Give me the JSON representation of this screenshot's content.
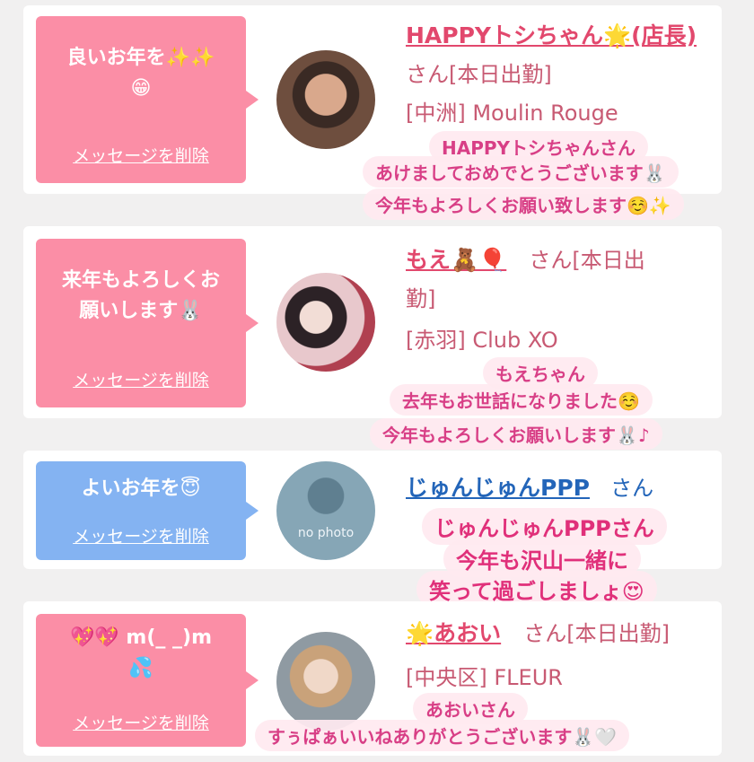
{
  "cards": [
    {
      "message": "良いお年を✨✨\n😁",
      "delete_label": "メッセージを削除",
      "name": "HAPPYトシちゃん🌟(店長)",
      "suffix": "さん[本日出勤]",
      "shop": "[中洲] Moulin Rouge",
      "overlay": [
        "HAPPYトシちゃんさん",
        "あけましておめでとうございます🐰",
        "今年もよろしくお願い致します☺️✨"
      ]
    },
    {
      "message": "来年もよろしくお\n願いします🐰",
      "delete_label": "メッセージを削除",
      "name": "もえ🧸🎈",
      "suffix": "さん[本日出",
      "suffix2": "勤]",
      "shop": "[赤羽] Club XO",
      "overlay": [
        "もえちゃん",
        "去年もお世話になりました☺️",
        "今年もよろしくお願いします🐰♪"
      ]
    },
    {
      "message": "よいお年を😇",
      "delete_label": "メッセージを削除",
      "name": "じゅんじゅんPPP",
      "suffix": "さん",
      "avatar_text": "no photo",
      "overlay": [
        "じゅんじゅんPPPさん",
        "今年も沢山一緒に",
        "笑って過ごしましょ😍"
      ]
    },
    {
      "message": "💖💖    m(_ _)m\n💦",
      "delete_label": "メッセージを削除",
      "name": "🌟あおい",
      "suffix": "さん[本日出勤]",
      "shop": "[中央区] FLEUR",
      "overlay": [
        "あおいさん",
        "すぅぱぁいいねありがとうございます🐰🤍"
      ]
    }
  ]
}
